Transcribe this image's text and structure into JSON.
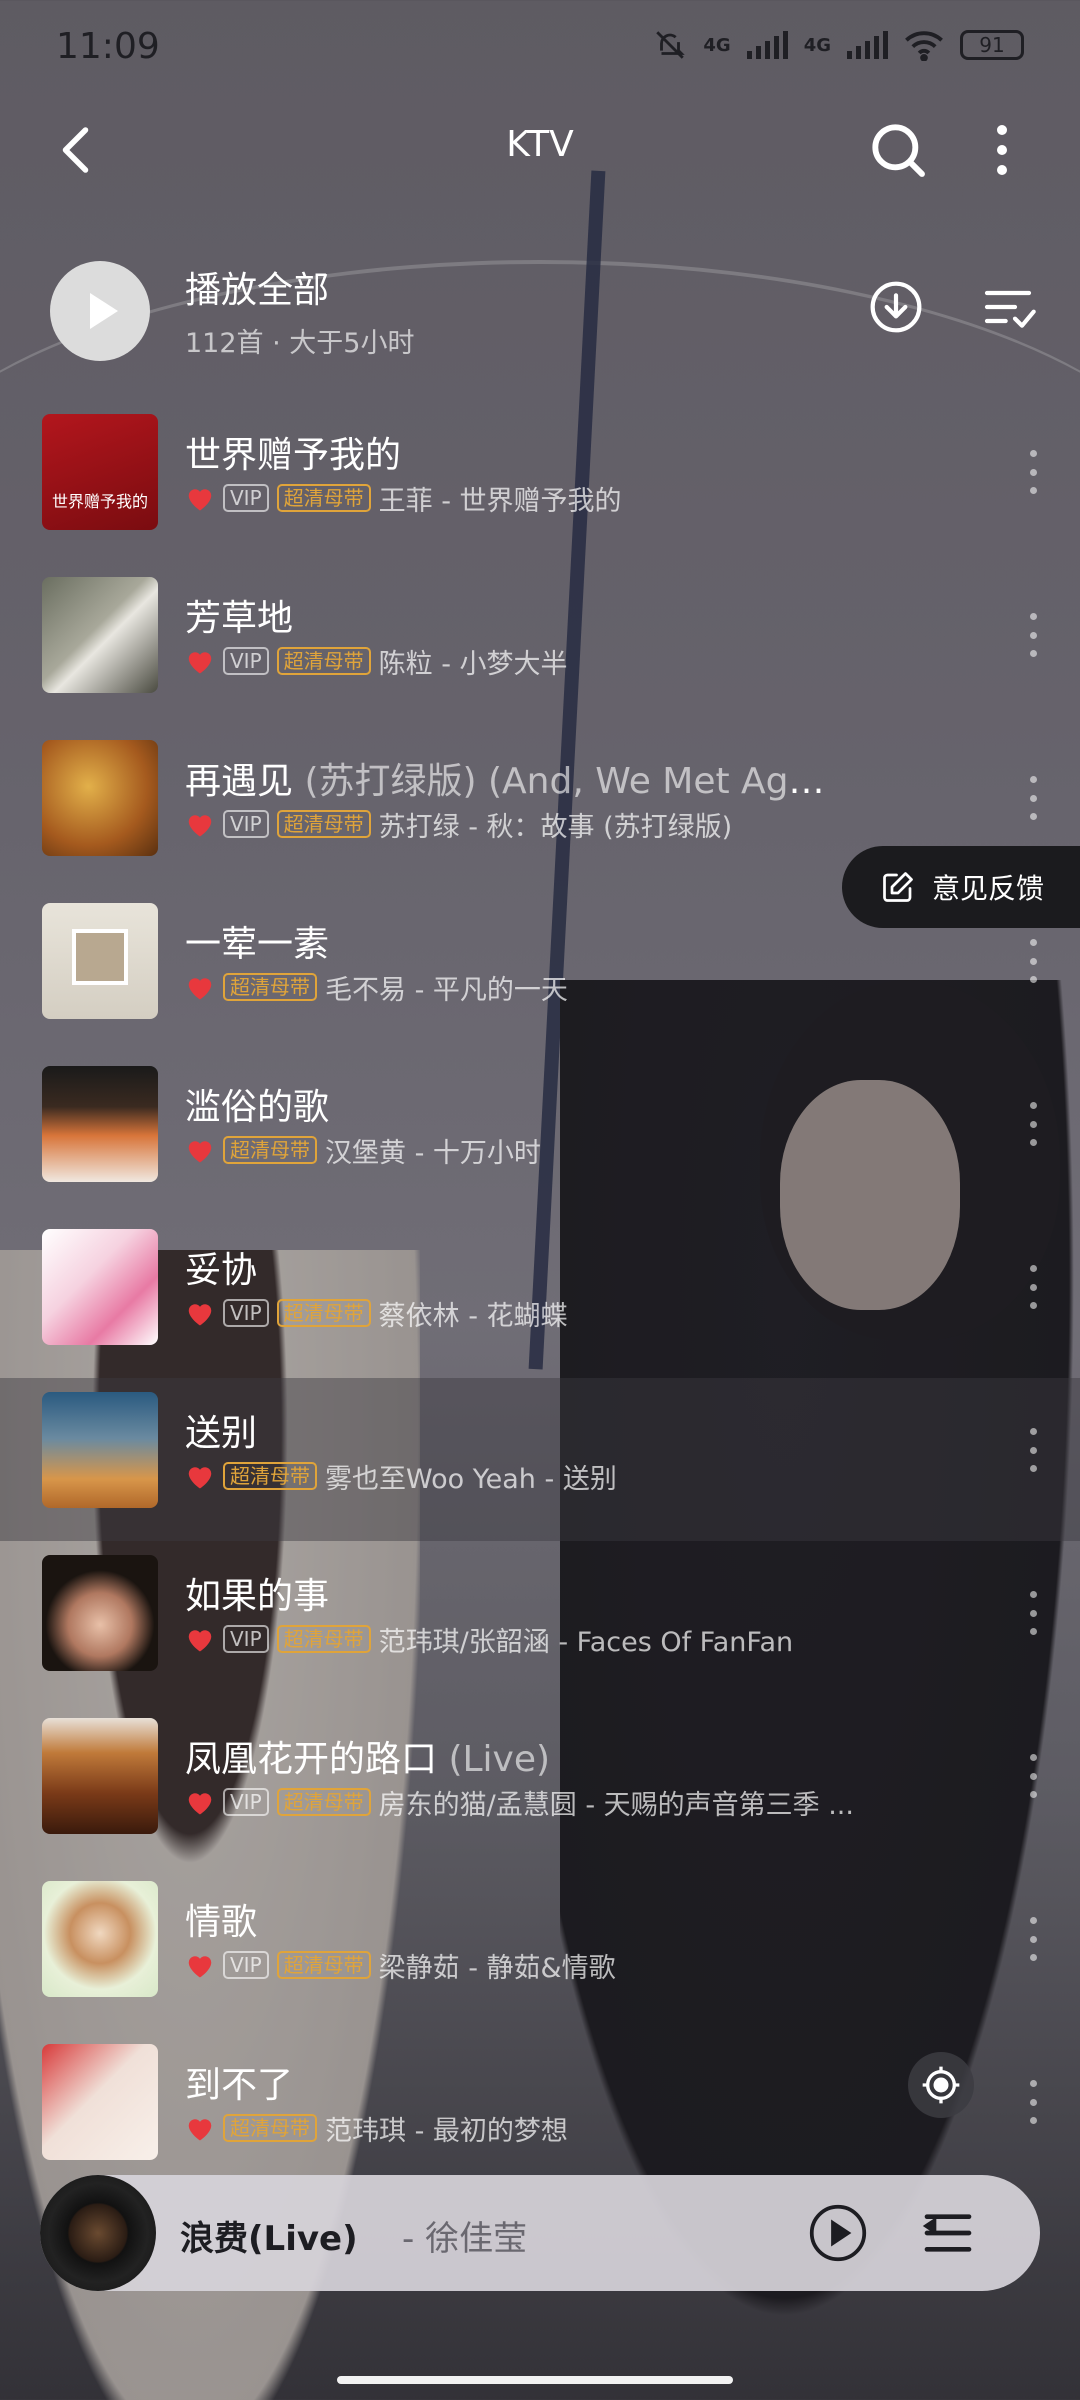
{
  "status_bar": {
    "time": "11:09",
    "network_1": "4G",
    "network_2": "4G",
    "battery": "91"
  },
  "header": {
    "title": "KTV"
  },
  "play_all": {
    "title": "播放全部",
    "subtitle": "112首 · 大于5小时"
  },
  "colors": {
    "accent_red": "#e8383d",
    "hq_tag": "#e0a43a"
  },
  "tags": {
    "vip": "VIP",
    "hq": "超清母带"
  },
  "songs": [
    {
      "title": "世界赠予我的",
      "subtitle": "",
      "vip": true,
      "artist": "王菲 - 世界赠予我的",
      "cover_text": "世界赠予我的"
    },
    {
      "title": "芳草地",
      "subtitle": "",
      "vip": true,
      "artist": "陈粒 - 小梦大半"
    },
    {
      "title": "再遇见 ",
      "subtitle": "(苏打绿版) (And, We Met Aga...",
      "vip": true,
      "artist": "苏打绿 - 秋：故事 (苏打绿版)"
    },
    {
      "title": "一荤一素",
      "subtitle": "",
      "vip": false,
      "artist": "毛不易 - 平凡的一天"
    },
    {
      "title": "滥俗的歌",
      "subtitle": "",
      "vip": false,
      "artist": "汉堡黄 - 十万小时"
    },
    {
      "title": "妥协",
      "subtitle": "",
      "vip": true,
      "artist": "蔡依林 - 花蝴蝶"
    },
    {
      "title": "送别",
      "subtitle": "",
      "vip": false,
      "artist": "雾也至Woo Yeah - 送别"
    },
    {
      "title": "如果的事",
      "subtitle": "",
      "vip": true,
      "artist": "范玮琪/张韶涵 - Faces Of FanFan"
    },
    {
      "title": "凤凰花开的路口 ",
      "subtitle": "(Live)",
      "vip": true,
      "artist": "房东的猫/孟慧圆 - 天赐的声音第三季 ..."
    },
    {
      "title": "情歌",
      "subtitle": "",
      "vip": true,
      "artist": "梁静茹 - 静茹&情歌"
    },
    {
      "title": "到不了",
      "subtitle": "",
      "vip": false,
      "artist": "范玮琪 - 最初的梦想"
    }
  ],
  "feedback": {
    "label": "意见反馈"
  },
  "now_playing": {
    "title": "浪费(Live)",
    "artist": "- 徐佳莹"
  }
}
